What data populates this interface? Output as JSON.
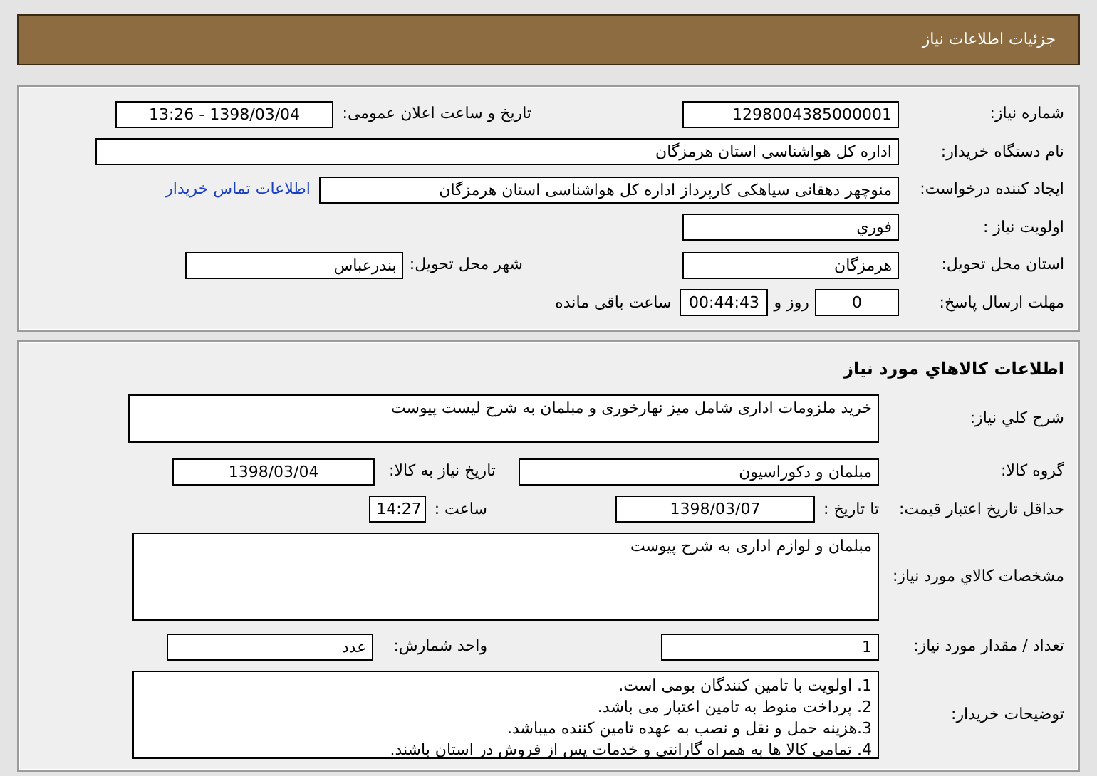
{
  "header": {
    "title": "جزئیات اطلاعات نیاز"
  },
  "need_info": {
    "need_number": {
      "label": "شماره نیاز:",
      "value": "1298004385000001"
    },
    "announce_datetime": {
      "label": "تاریخ و ساعت اعلان عمومی:",
      "value": "1398/03/04 - 13:26"
    },
    "buyer_org": {
      "label": "نام دستگاه خریدار:",
      "value": "اداره کل هواشناسی استان هرمزگان"
    },
    "requester": {
      "label": "ایجاد کننده درخواست:",
      "value": "منوچهر دهقانی سیاهکی کارپرداز اداره کل هواشناسی استان هرمزگان",
      "link": "اطلاعات تماس خریدار"
    },
    "priority": {
      "label": "اولویت نیاز :",
      "value": "فوري"
    },
    "delivery_province": {
      "label": "استان محل تحویل:",
      "value": "هرمزگان"
    },
    "delivery_city": {
      "label": "شهر محل تحویل:",
      "value": "بندرعباس"
    },
    "deadline": {
      "label": "مهلت ارسال پاسخ:",
      "days": "0",
      "days_suffix": "روز و",
      "time": "00:44:43",
      "time_suffix": "ساعت باقی مانده"
    }
  },
  "goods_info": {
    "title": "اطلاعات کالاهاي مورد نیاز",
    "description": {
      "label": "شرح کلي نیاز:",
      "value": "خرید ملزومات اداری شامل میز نهارخوری و مبلمان به شرح لیست پیوست"
    },
    "goods_group": {
      "label": "گروه کالا:",
      "value": "مبلمان و دکوراسیون"
    },
    "need_date": {
      "label": "تاریخ نیاز به کالا:",
      "value": "1398/03/04"
    },
    "price_validity": {
      "label": "حداقل تاریخ اعتبار قیمت:",
      "to_date_label": "تا تاریخ :",
      "date": "1398/03/07",
      "time_label": "ساعت :",
      "time": "14:27"
    },
    "specs": {
      "label": "مشخصات کالاي مورد نیاز:",
      "value": "مبلمان و لوازم اداری به شرح پیوست"
    },
    "quantity": {
      "label": "تعداد / مقدار مورد نیاز:",
      "value": "1"
    },
    "unit": {
      "label": "واحد شمارش:",
      "value": "عدد"
    },
    "buyer_notes": {
      "label": "توضیحات خریدار:",
      "lines": [
        "1. اولویت با تامین کنندگان بومی است.",
        "2. پرداخت منوط به تامین اعتبار می باشد.",
        "3.هزینه حمل و نقل و نصب به عهده تامین کننده میباشد.",
        "4. تمامی کالا ها به همراه گارانتی و خدمات پس از فروش در استان باشند."
      ]
    }
  }
}
